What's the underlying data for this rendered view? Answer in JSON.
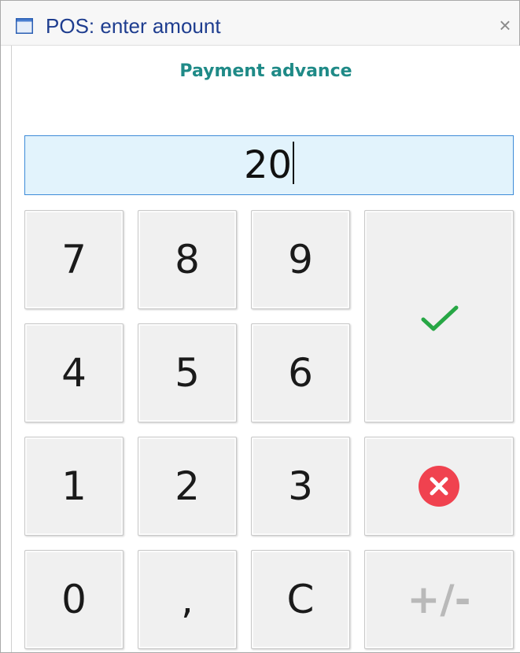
{
  "window": {
    "title": "POS: enter amount",
    "close_glyph": "×",
    "icon": "window-icon"
  },
  "heading": "Payment advance",
  "amount": {
    "value": "20"
  },
  "keypad": {
    "keys": {
      "k7": "7",
      "k8": "8",
      "k9": "9",
      "k4": "4",
      "k5": "5",
      "k6": "6",
      "k1": "1",
      "k2": "2",
      "k3": "3",
      "k0": "0",
      "comma": ",",
      "clear": "C",
      "sign": "+/-"
    },
    "confirm_icon": "checkmark-icon",
    "cancel_icon": "cancel-icon"
  },
  "colors": {
    "heading": "#1f8a87",
    "input_bg": "#e2f3fc",
    "input_border": "#3d8bd8",
    "confirm": "#27a745",
    "cancel": "#f0424f",
    "disabled_text": "#b9b9b9"
  }
}
